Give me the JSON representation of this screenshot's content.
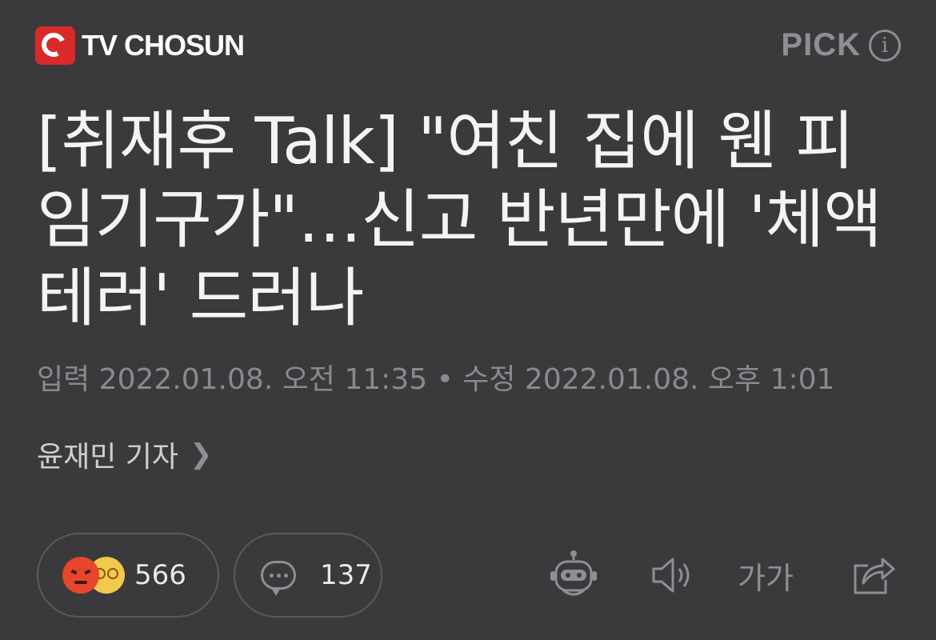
{
  "header": {
    "brand_name": "TV CHOSUN",
    "pick_label": "PICK",
    "info_icon": "info-icon"
  },
  "article": {
    "title": "[취재후 Talk] \"여친 집에 웬 피임기구가\"…신고 반년만에 '체액테러' 드러나",
    "meta": "입력 2022.01.08. 오전 11:35 • 수정 2022.01.08. 오후 1:01",
    "reporter": "윤재민 기자"
  },
  "actions": {
    "reaction_count": "566",
    "comment_count": "137",
    "font_label": "가가",
    "icons": [
      "angry-emoji-icon",
      "dizzy-emoji-icon",
      "comment-icon",
      "robot-summary-icon",
      "speaker-icon",
      "font-size-icon",
      "share-icon"
    ]
  }
}
